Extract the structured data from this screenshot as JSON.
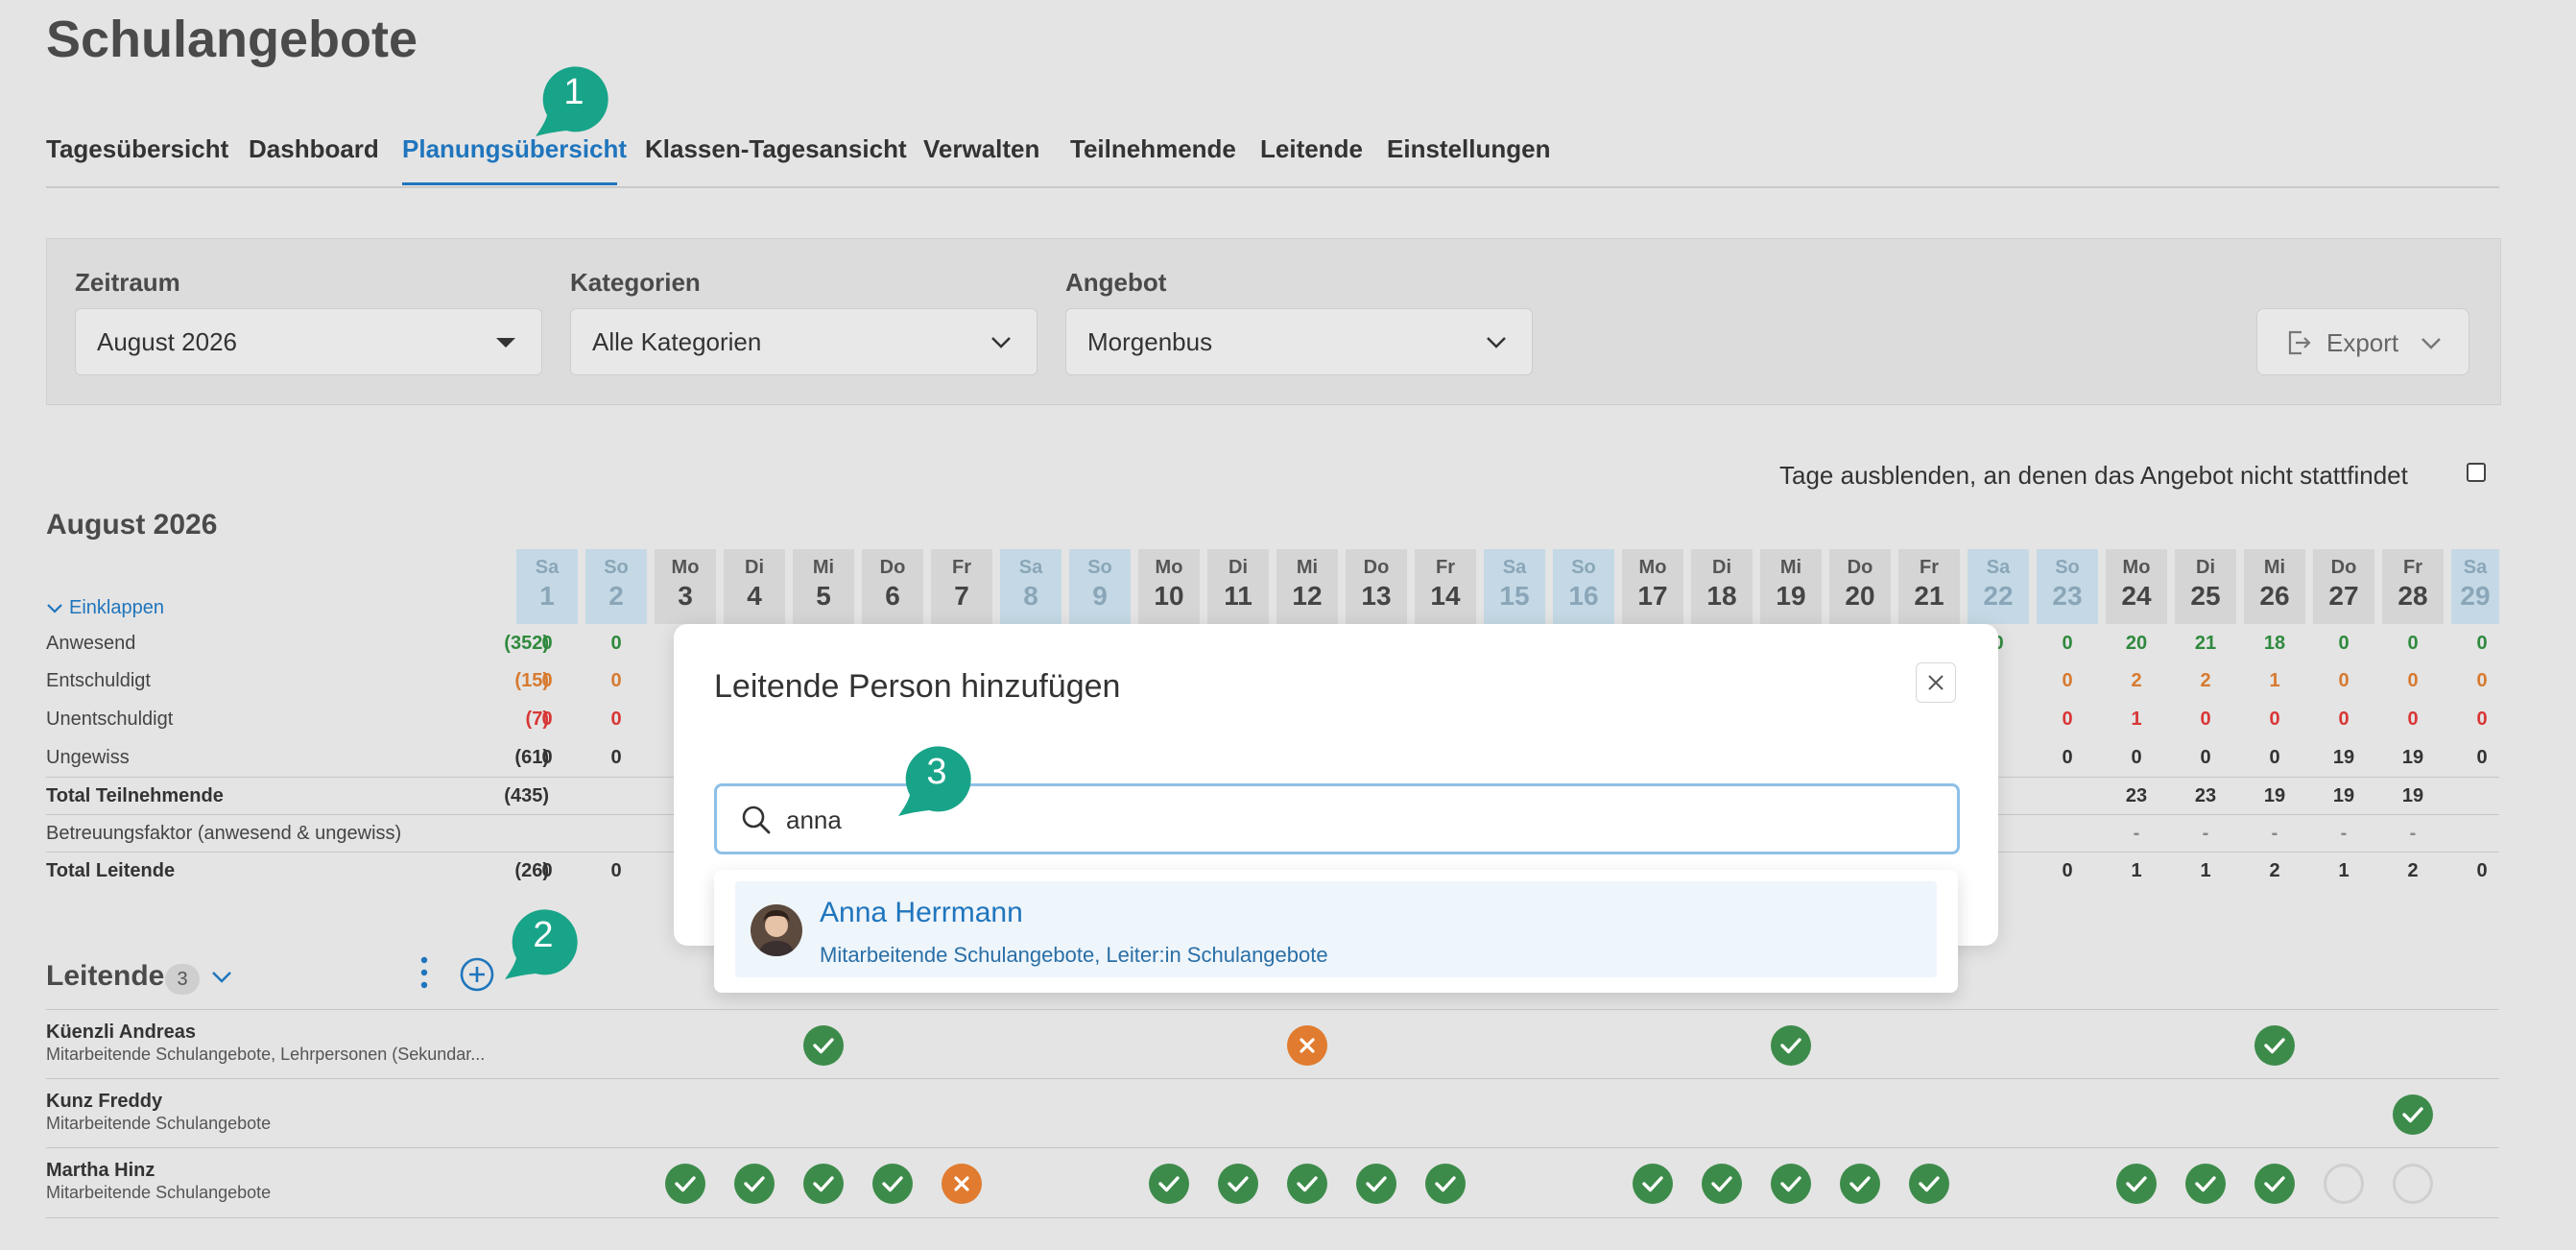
{
  "page": {
    "title": "Schulangebote"
  },
  "tabs": [
    {
      "label": "Tagesübersicht",
      "active": false
    },
    {
      "label": "Dashboard",
      "active": false
    },
    {
      "label": "Planungsübersicht",
      "active": true
    },
    {
      "label": "Klassen-Tagesansicht",
      "active": false
    },
    {
      "label": "Verwalten",
      "active": false
    },
    {
      "label": "Teilnehmende",
      "active": false
    },
    {
      "label": "Leitende",
      "active": false
    },
    {
      "label": "Einstellungen",
      "active": false
    }
  ],
  "filters": {
    "zeitraum": {
      "label": "Zeitraum",
      "value": "August 2026"
    },
    "kategorien": {
      "label": "Kategorien",
      "value": "Alle Kategorien"
    },
    "angebot": {
      "label": "Angebot",
      "value": "Morgenbus"
    },
    "export_label": "Export"
  },
  "hide_days_label": "Tage ausblenden, an denen das Angebot nicht stattfindet",
  "hide_days_checked": false,
  "calendar": {
    "month_title": "August 2026",
    "collapse_label": "Einklappen",
    "days": [
      {
        "wd": "Sa",
        "d": "1",
        "we": true
      },
      {
        "wd": "So",
        "d": "2",
        "we": true
      },
      {
        "wd": "Mo",
        "d": "3",
        "we": false
      },
      {
        "wd": "Di",
        "d": "4",
        "we": false
      },
      {
        "wd": "Mi",
        "d": "5",
        "we": false
      },
      {
        "wd": "Do",
        "d": "6",
        "we": false
      },
      {
        "wd": "Fr",
        "d": "7",
        "we": false
      },
      {
        "wd": "Sa",
        "d": "8",
        "we": true
      },
      {
        "wd": "So",
        "d": "9",
        "we": true
      },
      {
        "wd": "Mo",
        "d": "10",
        "we": false
      },
      {
        "wd": "Di",
        "d": "11",
        "we": false
      },
      {
        "wd": "Mi",
        "d": "12",
        "we": false
      },
      {
        "wd": "Do",
        "d": "13",
        "we": false
      },
      {
        "wd": "Fr",
        "d": "14",
        "we": false
      },
      {
        "wd": "Sa",
        "d": "15",
        "we": true
      },
      {
        "wd": "So",
        "d": "16",
        "we": true
      },
      {
        "wd": "Mo",
        "d": "17",
        "we": false
      },
      {
        "wd": "Di",
        "d": "18",
        "we": false
      },
      {
        "wd": "Mi",
        "d": "19",
        "we": false
      },
      {
        "wd": "Do",
        "d": "20",
        "we": false
      },
      {
        "wd": "Fr",
        "d": "21",
        "we": false
      },
      {
        "wd": "Sa",
        "d": "22",
        "we": true
      },
      {
        "wd": "So",
        "d": "23",
        "we": true
      },
      {
        "wd": "Mo",
        "d": "24",
        "we": false
      },
      {
        "wd": "Di",
        "d": "25",
        "we": false
      },
      {
        "wd": "Mi",
        "d": "26",
        "we": false
      },
      {
        "wd": "Do",
        "d": "27",
        "we": false
      },
      {
        "wd": "Fr",
        "d": "28",
        "we": false
      },
      {
        "wd": "Sa",
        "d": "29",
        "we": true
      }
    ]
  },
  "stats_rows": [
    {
      "label": "Anwesend",
      "total": "(352)",
      "color": "green",
      "bold": false,
      "left": [
        [
          "0",
          0
        ],
        [
          "0",
          1
        ]
      ],
      "right": [
        [
          "0",
          21
        ],
        [
          "0",
          22
        ],
        [
          "20",
          23
        ],
        [
          "21",
          24
        ],
        [
          "18",
          25
        ],
        [
          "0",
          26
        ],
        [
          "0",
          27
        ],
        [
          "0",
          28
        ]
      ]
    },
    {
      "label": "Entschuldigt",
      "total": "(15)",
      "color": "orange",
      "bold": false,
      "left": [
        [
          "0",
          0
        ],
        [
          "0",
          1
        ]
      ],
      "right": [
        [
          "0",
          22
        ],
        [
          "2",
          23
        ],
        [
          "2",
          24
        ],
        [
          "1",
          25
        ],
        [
          "0",
          26
        ],
        [
          "0",
          27
        ],
        [
          "0",
          28
        ]
      ]
    },
    {
      "label": "Unentschuldigt",
      "total": "(7)",
      "color": "red",
      "bold": false,
      "left": [
        [
          "0",
          0
        ],
        [
          "0",
          1
        ]
      ],
      "right": [
        [
          "0",
          22
        ],
        [
          "1",
          23
        ],
        [
          "0",
          24
        ],
        [
          "0",
          25
        ],
        [
          "0",
          26
        ],
        [
          "0",
          27
        ],
        [
          "0",
          28
        ]
      ]
    },
    {
      "label": "Ungewiss",
      "total": "(61)",
      "color": "dark",
      "bold": false,
      "left": [
        [
          "0",
          0
        ],
        [
          "0",
          1
        ]
      ],
      "right": [
        [
          "0",
          22
        ],
        [
          "0",
          23
        ],
        [
          "0",
          24
        ],
        [
          "0",
          25
        ],
        [
          "19",
          26
        ],
        [
          "19",
          27
        ],
        [
          "0",
          28
        ]
      ]
    },
    {
      "label": "Total Teilnehmende",
      "total": "(435)",
      "color": "dark",
      "bold": true,
      "left": [],
      "right": [
        [
          "23",
          23
        ],
        [
          "23",
          24
        ],
        [
          "19",
          25
        ],
        [
          "19",
          26
        ],
        [
          "19",
          27
        ]
      ]
    },
    {
      "label": "Betreuungsfaktor (anwesend & ungewiss)",
      "total": "",
      "color": "gray",
      "bold": false,
      "left": [],
      "right": [
        [
          "-",
          23
        ],
        [
          "-",
          24
        ],
        [
          "-",
          25
        ],
        [
          "-",
          26
        ],
        [
          "-",
          27
        ]
      ]
    },
    {
      "label": "Total Leitende",
      "total": "(26)",
      "color": "dark",
      "bold": true,
      "left": [
        [
          "0",
          0
        ],
        [
          "0",
          1
        ]
      ],
      "right": [
        [
          "0",
          22
        ],
        [
          "1",
          23
        ],
        [
          "1",
          24
        ],
        [
          "2",
          25
        ],
        [
          "1",
          26
        ],
        [
          "2",
          27
        ],
        [
          "0",
          28
        ]
      ]
    }
  ],
  "leitende": {
    "title": "Leitende",
    "count": "3",
    "people": [
      {
        "name": "Küenzli Andreas",
        "role": "Mitarbeitende Schulangebote, Lehrpersonen (Sekundar...",
        "marks": [
          [
            4,
            "ok"
          ],
          [
            11,
            "no"
          ],
          [
            18,
            "ok"
          ],
          [
            25,
            "ok"
          ]
        ]
      },
      {
        "name": "Kunz Freddy",
        "role": "Mitarbeitende Schulangebote",
        "marks": [
          [
            27,
            "ok"
          ]
        ]
      },
      {
        "name": "Martha Hinz",
        "role": "Mitarbeitende Schulangebote",
        "marks": [
          [
            2,
            "ok"
          ],
          [
            3,
            "ok"
          ],
          [
            4,
            "ok"
          ],
          [
            5,
            "ok"
          ],
          [
            6,
            "no"
          ],
          [
            9,
            "ok"
          ],
          [
            10,
            "ok"
          ],
          [
            11,
            "ok"
          ],
          [
            12,
            "ok"
          ],
          [
            13,
            "ok"
          ],
          [
            16,
            "ok"
          ],
          [
            17,
            "ok"
          ],
          [
            18,
            "ok"
          ],
          [
            19,
            "ok"
          ],
          [
            20,
            "ok"
          ],
          [
            23,
            "ok"
          ],
          [
            24,
            "ok"
          ],
          [
            25,
            "ok"
          ],
          [
            26,
            "none"
          ],
          [
            27,
            "none"
          ]
        ]
      }
    ]
  },
  "modal": {
    "title": "Leitende Person hinzufügen",
    "search_value": "anna",
    "result": {
      "name": "Anna Herrmann",
      "roles": "Mitarbeitende Schulangebote, Leiter:in Schulangebote"
    }
  },
  "callouts": [
    {
      "number": "1"
    },
    {
      "number": "2"
    },
    {
      "number": "3"
    }
  ],
  "colors": {
    "accent": "#1f75bd",
    "callout": "#18a489",
    "ok": "#3d8b4a",
    "no": "#e07b2f"
  }
}
